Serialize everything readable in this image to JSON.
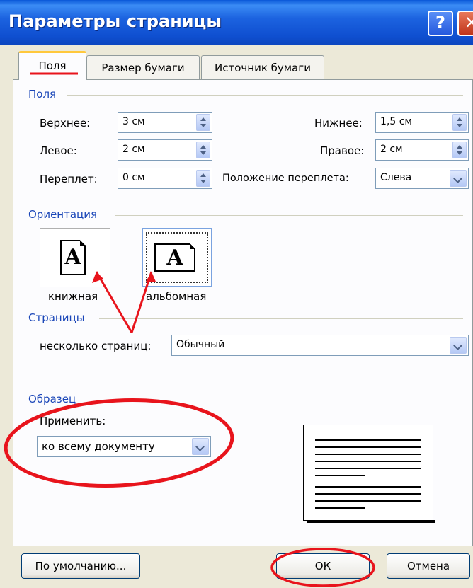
{
  "window": {
    "title": "Параметры страницы"
  },
  "tabs": [
    {
      "label": "Поля",
      "active": true
    },
    {
      "label": "Размер бумаги"
    },
    {
      "label": "Источник бумаги"
    }
  ],
  "margins": {
    "group_label": "Поля",
    "top": {
      "label": "Верхнее:",
      "value": "3 см"
    },
    "bottom": {
      "label": "Нижнее:",
      "value": "1,5 см"
    },
    "left": {
      "label": "Левое:",
      "value": "2 см"
    },
    "right": {
      "label": "Правое:",
      "value": "2 см"
    },
    "gutter": {
      "label": "Переплет:",
      "value": "0 см"
    },
    "gutter_position": {
      "label": "Положение переплета:",
      "value": "Слева"
    }
  },
  "orientation": {
    "group_label": "Ориентация",
    "portrait": {
      "label": "книжная",
      "glyph": "A"
    },
    "landscape": {
      "label": "альбомная",
      "glyph": "A",
      "selected": true
    }
  },
  "pages": {
    "group_label": "Страницы",
    "multiple": {
      "label": "несколько страниц:",
      "value": "Обычный"
    }
  },
  "sample": {
    "group_label": "Образец",
    "apply": {
      "label": "Применить:",
      "value": "ко всему документу"
    }
  },
  "buttons": {
    "default": "По умолчанию...",
    "ok": "ОК",
    "cancel": "Отмена"
  },
  "colors": {
    "annotation": "#E8141C",
    "titlebar": "#0B55D8",
    "group_label": "#1A46B8"
  }
}
